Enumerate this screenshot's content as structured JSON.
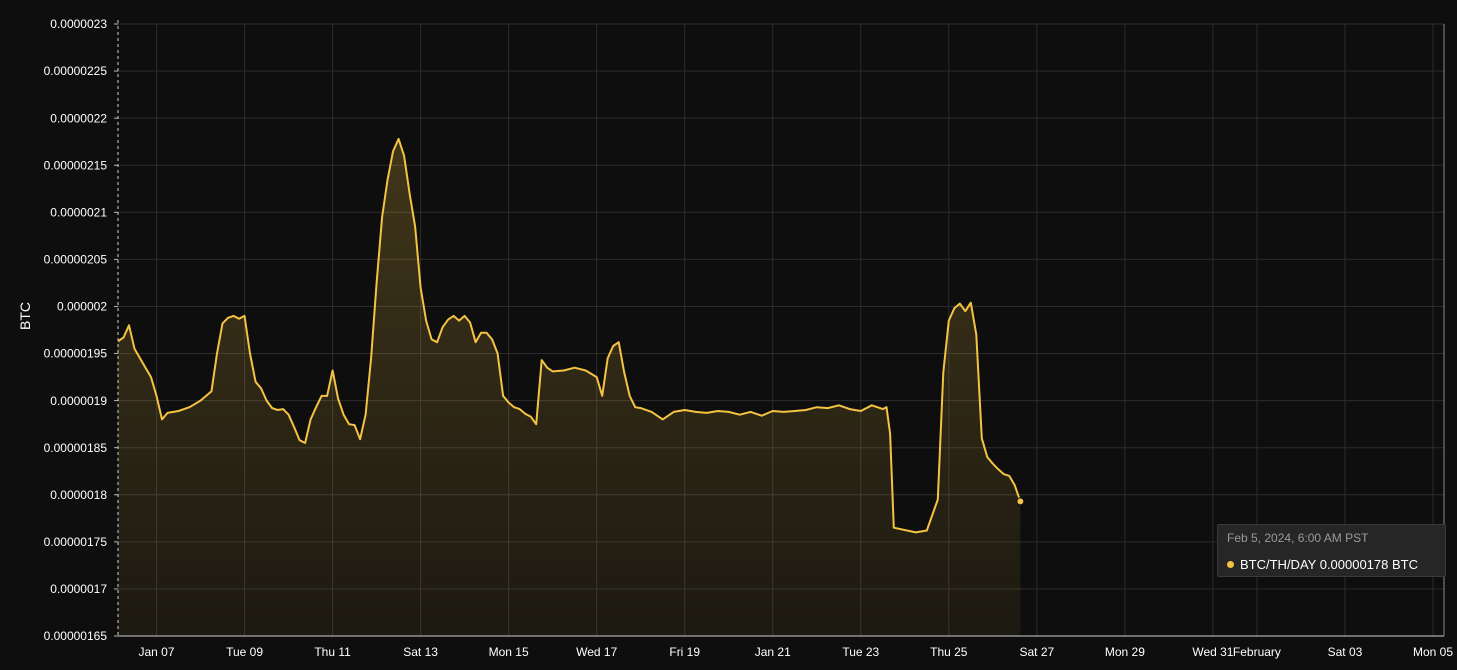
{
  "chart_data": {
    "type": "area",
    "ylabel": "BTC",
    "ylim": [
      1.65e-06,
      2.3e-06
    ],
    "y_ticks": [
      "0.0000023",
      "0.00000225",
      "0.0000022",
      "0.00000215",
      "0.0000021",
      "0.00000205",
      "0.000002",
      "0.00000195",
      "0.0000019",
      "0.00000185",
      "0.0000018",
      "0.00000175",
      "0.0000017",
      "0.00000165"
    ],
    "x_range": [
      "2024-01-06T03:00",
      "2024-02-05T06:00"
    ],
    "x_ticks": [
      {
        "date": "2024-01-07",
        "label": "Jan 07"
      },
      {
        "date": "2024-01-09",
        "label": "Tue 09"
      },
      {
        "date": "2024-01-11",
        "label": "Thu 11"
      },
      {
        "date": "2024-01-13",
        "label": "Sat 13"
      },
      {
        "date": "2024-01-15",
        "label": "Mon 15"
      },
      {
        "date": "2024-01-17",
        "label": "Wed 17"
      },
      {
        "date": "2024-01-19",
        "label": "Fri 19"
      },
      {
        "date": "2024-01-21",
        "label": "Jan 21"
      },
      {
        "date": "2024-01-23",
        "label": "Tue 23"
      },
      {
        "date": "2024-01-25",
        "label": "Thu 25"
      },
      {
        "date": "2024-01-27",
        "label": "Sat 27"
      },
      {
        "date": "2024-01-29",
        "label": "Mon 29"
      },
      {
        "date": "2024-01-31",
        "label": "Wed 31"
      },
      {
        "date": "2024-02-01",
        "label": "February"
      },
      {
        "date": "2024-02-03",
        "label": "Sat 03"
      },
      {
        "date": "2024-02-05",
        "label": "Mon 05"
      }
    ],
    "grid": true,
    "series": [
      {
        "name": "BTC/TH/DAY",
        "color": "#f5c342",
        "points": [
          [
            "2024-01-06T03:00",
            1.963e-06
          ],
          [
            "2024-01-06T06:00",
            1.967e-06
          ],
          [
            "2024-01-06T09:00",
            1.98e-06
          ],
          [
            "2024-01-06T12:00",
            1.955e-06
          ],
          [
            "2024-01-06T15:00",
            1.945e-06
          ],
          [
            "2024-01-06T18:00",
            1.935e-06
          ],
          [
            "2024-01-06T21:00",
            1.925e-06
          ],
          [
            "2024-01-07T00:00",
            1.905e-06
          ],
          [
            "2024-01-07T03:00",
            1.88e-06
          ],
          [
            "2024-01-07T06:00",
            1.887e-06
          ],
          [
            "2024-01-07T12:00",
            1.889e-06
          ],
          [
            "2024-01-07T18:00",
            1.893e-06
          ],
          [
            "2024-01-08T00:00",
            1.9e-06
          ],
          [
            "2024-01-08T06:00",
            1.91e-06
          ],
          [
            "2024-01-08T09:00",
            1.95e-06
          ],
          [
            "2024-01-08T12:00",
            1.982e-06
          ],
          [
            "2024-01-08T15:00",
            1.988e-06
          ],
          [
            "2024-01-08T18:00",
            1.99e-06
          ],
          [
            "2024-01-08T21:00",
            1.987e-06
          ],
          [
            "2024-01-09T00:00",
            1.99e-06
          ],
          [
            "2024-01-09T03:00",
            1.95e-06
          ],
          [
            "2024-01-09T06:00",
            1.92e-06
          ],
          [
            "2024-01-09T09:00",
            1.913e-06
          ],
          [
            "2024-01-09T12:00",
            1.9e-06
          ],
          [
            "2024-01-09T15:00",
            1.892e-06
          ],
          [
            "2024-01-09T18:00",
            1.89e-06
          ],
          [
            "2024-01-09T21:00",
            1.891e-06
          ],
          [
            "2024-01-10T00:00",
            1.885e-06
          ],
          [
            "2024-01-10T03:00",
            1.872e-06
          ],
          [
            "2024-01-10T06:00",
            1.858e-06
          ],
          [
            "2024-01-10T09:00",
            1.855e-06
          ],
          [
            "2024-01-10T12:00",
            1.88e-06
          ],
          [
            "2024-01-10T15:00",
            1.893e-06
          ],
          [
            "2024-01-10T18:00",
            1.905e-06
          ],
          [
            "2024-01-10T21:00",
            1.905e-06
          ],
          [
            "2024-01-11T00:00",
            1.932e-06
          ],
          [
            "2024-01-11T03:00",
            1.902e-06
          ],
          [
            "2024-01-11T06:00",
            1.885e-06
          ],
          [
            "2024-01-11T09:00",
            1.875e-06
          ],
          [
            "2024-01-11T12:00",
            1.874e-06
          ],
          [
            "2024-01-11T15:00",
            1.859e-06
          ],
          [
            "2024-01-11T18:00",
            1.885e-06
          ],
          [
            "2024-01-11T21:00",
            1.945e-06
          ],
          [
            "2024-01-12T00:00",
            2.025e-06
          ],
          [
            "2024-01-12T03:00",
            2.095e-06
          ],
          [
            "2024-01-12T06:00",
            2.135e-06
          ],
          [
            "2024-01-12T09:00",
            2.165e-06
          ],
          [
            "2024-01-12T12:00",
            2.178e-06
          ],
          [
            "2024-01-12T15:00",
            2.16e-06
          ],
          [
            "2024-01-12T18:00",
            2.12e-06
          ],
          [
            "2024-01-12T21:00",
            2.085e-06
          ],
          [
            "2024-01-13T00:00",
            2.02e-06
          ],
          [
            "2024-01-13T03:00",
            1.985e-06
          ],
          [
            "2024-01-13T06:00",
            1.965e-06
          ],
          [
            "2024-01-13T09:00",
            1.962e-06
          ],
          [
            "2024-01-13T12:00",
            1.978e-06
          ],
          [
            "2024-01-13T15:00",
            1.986e-06
          ],
          [
            "2024-01-13T18:00",
            1.99e-06
          ],
          [
            "2024-01-13T21:00",
            1.985e-06
          ],
          [
            "2024-01-14T00:00",
            1.99e-06
          ],
          [
            "2024-01-14T03:00",
            1.983e-06
          ],
          [
            "2024-01-14T06:00",
            1.962e-06
          ],
          [
            "2024-01-14T09:00",
            1.972e-06
          ],
          [
            "2024-01-14T12:00",
            1.972e-06
          ],
          [
            "2024-01-14T15:00",
            1.965e-06
          ],
          [
            "2024-01-14T18:00",
            1.95e-06
          ],
          [
            "2024-01-14T21:00",
            1.905e-06
          ],
          [
            "2024-01-15T00:00",
            1.898e-06
          ],
          [
            "2024-01-15T03:00",
            1.893e-06
          ],
          [
            "2024-01-15T06:00",
            1.891e-06
          ],
          [
            "2024-01-15T09:00",
            1.886e-06
          ],
          [
            "2024-01-15T12:00",
            1.883e-06
          ],
          [
            "2024-01-15T15:00",
            1.875e-06
          ],
          [
            "2024-01-15T18:00",
            1.943e-06
          ],
          [
            "2024-01-15T21:00",
            1.935e-06
          ],
          [
            "2024-01-16T00:00",
            1.931e-06
          ],
          [
            "2024-01-16T06:00",
            1.932e-06
          ],
          [
            "2024-01-16T12:00",
            1.935e-06
          ],
          [
            "2024-01-16T18:00",
            1.932e-06
          ],
          [
            "2024-01-17T00:00",
            1.925e-06
          ],
          [
            "2024-01-17T03:00",
            1.905e-06
          ],
          [
            "2024-01-17T06:00",
            1.945e-06
          ],
          [
            "2024-01-17T09:00",
            1.958e-06
          ],
          [
            "2024-01-17T12:00",
            1.962e-06
          ],
          [
            "2024-01-17T15:00",
            1.93e-06
          ],
          [
            "2024-01-17T18:00",
            1.905e-06
          ],
          [
            "2024-01-17T21:00",
            1.893e-06
          ],
          [
            "2024-01-18T00:00",
            1.892e-06
          ],
          [
            "2024-01-18T06:00",
            1.888e-06
          ],
          [
            "2024-01-18T12:00",
            1.88e-06
          ],
          [
            "2024-01-18T18:00",
            1.888e-06
          ],
          [
            "2024-01-19T00:00",
            1.89e-06
          ],
          [
            "2024-01-19T06:00",
            1.888e-06
          ],
          [
            "2024-01-19T12:00",
            1.887e-06
          ],
          [
            "2024-01-19T18:00",
            1.889e-06
          ],
          [
            "2024-01-20T00:00",
            1.888e-06
          ],
          [
            "2024-01-20T06:00",
            1.885e-06
          ],
          [
            "2024-01-20T12:00",
            1.888e-06
          ],
          [
            "2024-01-20T18:00",
            1.884e-06
          ],
          [
            "2024-01-21T00:00",
            1.889e-06
          ],
          [
            "2024-01-21T06:00",
            1.888e-06
          ],
          [
            "2024-01-21T12:00",
            1.889e-06
          ],
          [
            "2024-01-21T18:00",
            1.89e-06
          ],
          [
            "2024-01-22T00:00",
            1.893e-06
          ],
          [
            "2024-01-22T06:00",
            1.892e-06
          ],
          [
            "2024-01-22T12:00",
            1.895e-06
          ],
          [
            "2024-01-22T18:00",
            1.891e-06
          ],
          [
            "2024-01-23T00:00",
            1.889e-06
          ],
          [
            "2024-01-23T06:00",
            1.895e-06
          ],
          [
            "2024-01-23T12:00",
            1.891e-06
          ],
          [
            "2024-01-23T14:00",
            1.893e-06
          ],
          [
            "2024-01-23T16:00",
            1.865e-06
          ],
          [
            "2024-01-23T18:00",
            1.765e-06
          ],
          [
            "2024-01-24T06:00",
            1.76e-06
          ],
          [
            "2024-01-24T12:00",
            1.762e-06
          ],
          [
            "2024-01-24T18:00",
            1.795e-06
          ],
          [
            "2024-01-24T21:00",
            1.93e-06
          ],
          [
            "2024-01-25T00:00",
            1.985e-06
          ],
          [
            "2024-01-25T03:00",
            1.998e-06
          ],
          [
            "2024-01-25T06:00",
            2.003e-06
          ],
          [
            "2024-01-25T09:00",
            1.995e-06
          ],
          [
            "2024-01-25T12:00",
            2.004e-06
          ],
          [
            "2024-01-25T15:00",
            1.97e-06
          ],
          [
            "2024-01-25T18:00",
            1.86e-06
          ],
          [
            "2024-01-25T21:00",
            1.84e-06
          ],
          [
            "2024-01-26T00:00",
            1.833e-06
          ],
          [
            "2024-01-26T03:00",
            1.827e-06
          ],
          [
            "2024-01-26T06:00",
            1.822e-06
          ],
          [
            "2024-01-26T09:00",
            1.82e-06
          ],
          [
            "2024-01-26T12:00",
            1.81e-06
          ],
          [
            "2024-01-26T15:00",
            1.793e-06
          ]
        ]
      }
    ]
  },
  "tooltip": {
    "date": "Feb 5, 2024, 6:00 AM PST",
    "label": "BTC/TH/DAY 0.00000178 BTC",
    "dot_color": "#f5c342"
  }
}
